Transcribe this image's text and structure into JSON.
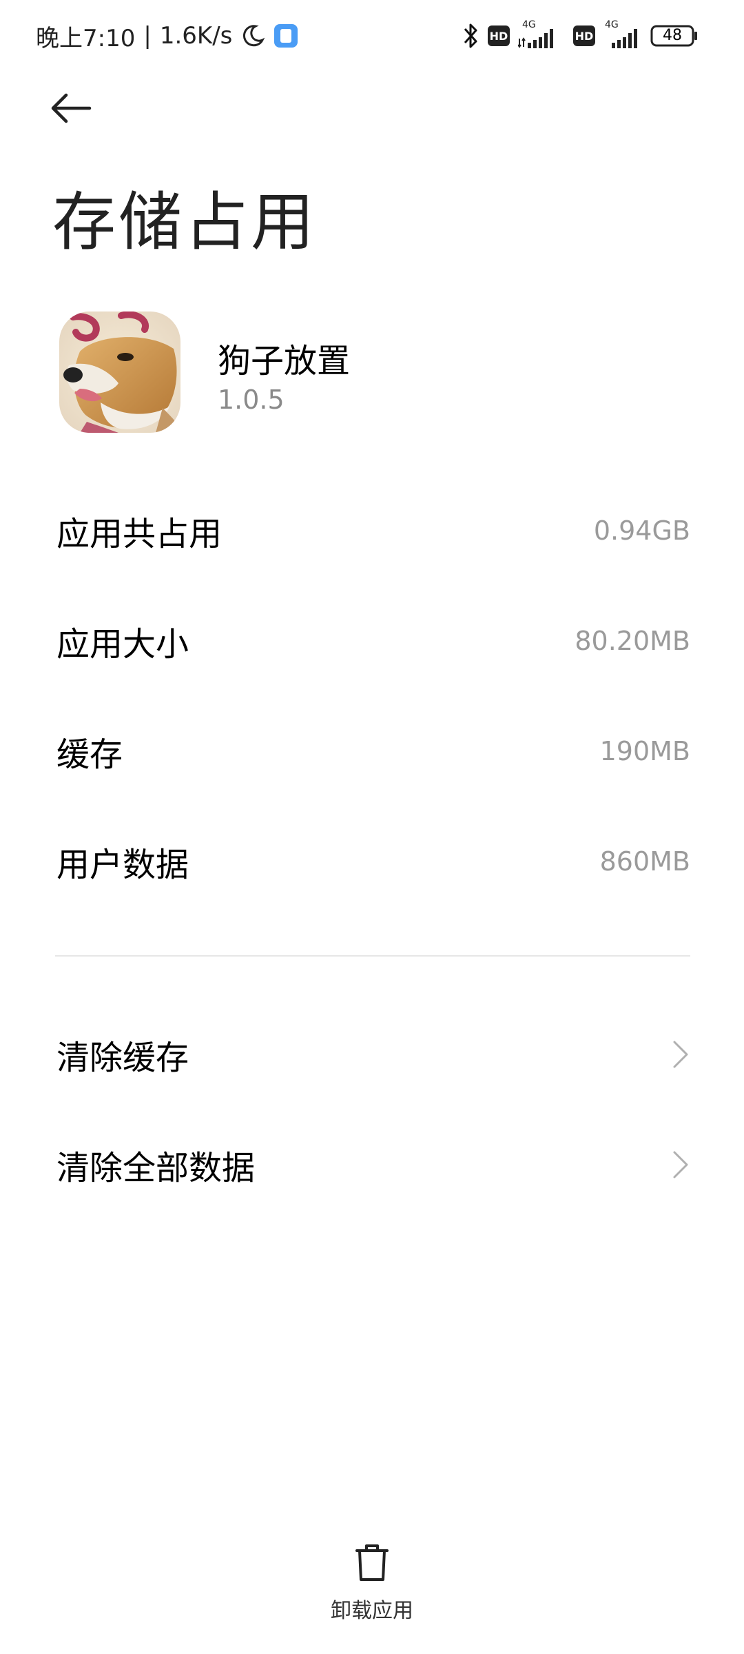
{
  "status_bar": {
    "time": "晚上7:10",
    "separator": "|",
    "speed": "1.6K/s",
    "battery": "48",
    "icons": [
      "moon-icon",
      "notification-icon",
      "bluetooth-icon",
      "hd-icon",
      "4g-signal-icon",
      "hd-icon",
      "4g-signal-icon",
      "battery-icon"
    ],
    "network_label_1": "4G",
    "network_label_2": "4G",
    "hd_label": "HD"
  },
  "header": {
    "back_icon": "back-arrow-icon",
    "title": "存储占用"
  },
  "app": {
    "name": "狗子放置",
    "version": "1.0.5",
    "icon": "app-icon"
  },
  "storage": {
    "items": [
      {
        "label": "应用共占用",
        "value": "0.94GB"
      },
      {
        "label": "应用大小",
        "value": "80.20MB"
      },
      {
        "label": "缓存",
        "value": "190MB"
      },
      {
        "label": "用户数据",
        "value": "860MB"
      }
    ]
  },
  "actions": {
    "items": [
      {
        "label": "清除缓存",
        "icon": "chevron-right-icon"
      },
      {
        "label": "清除全部数据",
        "icon": "chevron-right-icon"
      }
    ]
  },
  "bottom": {
    "uninstall_label": "卸载应用",
    "uninstall_icon": "trash-icon"
  },
  "colors": {
    "background": "#ffffff",
    "text_primary": "#000000",
    "text_secondary": "#9a9a9a",
    "divider": "#e6e6e6",
    "notification_accent": "#4a9cf5"
  }
}
